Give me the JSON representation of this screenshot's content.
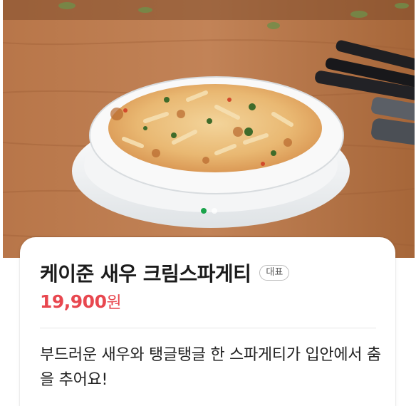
{
  "hero": {
    "image_icon": "pasta-gratin-photo",
    "carousel": {
      "total": 2,
      "active": 1
    }
  },
  "menu": {
    "name": "케이준 새우 크림스파게티",
    "badge": "대표",
    "price_amount": "19,900",
    "price_unit": "원",
    "description": "부드러운 새우와 탱글탱글 한 스파게티가 입안에서 춤을 추어요!"
  },
  "colors": {
    "price": "#e8474f",
    "active_dot": "#1aa34a",
    "title": "#1b1b1b"
  }
}
